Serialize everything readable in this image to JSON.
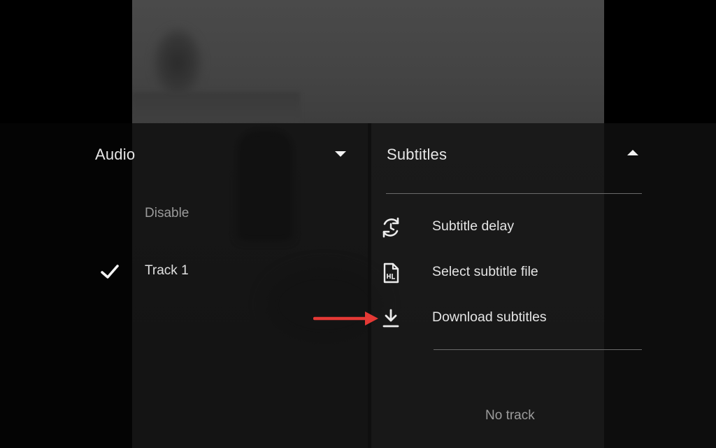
{
  "audio": {
    "title": "Audio",
    "options": [
      {
        "label": "Disable",
        "selected": false
      },
      {
        "label": "Track 1",
        "selected": true
      }
    ]
  },
  "subtitles": {
    "title": "Subtitles",
    "menu": [
      {
        "label": "Subtitle delay",
        "icon": "timer-sync-icon"
      },
      {
        "label": "Select subtitle file",
        "icon": "subtitle-file-icon"
      },
      {
        "label": "Download subtitles",
        "icon": "download-icon"
      }
    ],
    "empty_track_label": "No track"
  },
  "colors": {
    "annotation_arrow": "#e53935",
    "text_primary": "#e4e4e4",
    "text_dim": "#9a9a9a"
  }
}
